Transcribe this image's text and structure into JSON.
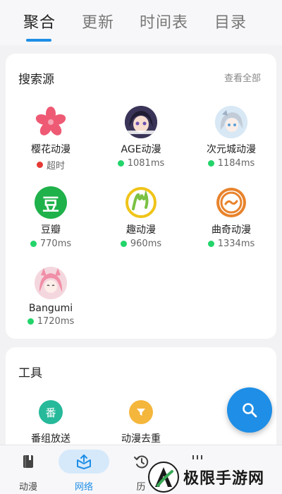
{
  "tabs": [
    {
      "label": "聚合",
      "active": true
    },
    {
      "label": "更新",
      "active": false
    },
    {
      "label": "时间表",
      "active": false
    },
    {
      "label": "目录",
      "active": false
    }
  ],
  "sources_card": {
    "title": "搜索源",
    "view_all": "查看全部",
    "items": [
      {
        "name": "樱花动漫",
        "status": "超时",
        "status_color": "#e53935",
        "icon": "sakura-flower-icon"
      },
      {
        "name": "AGE动漫",
        "status": "1081ms",
        "status_color": "#22d46a",
        "icon": "anime-girl-avatar"
      },
      {
        "name": "次元城动漫",
        "status": "1184ms",
        "status_color": "#22d46a",
        "icon": "anime-character-avatar"
      },
      {
        "name": "豆瓣",
        "status": "770ms",
        "status_color": "#22d46a",
        "icon": "douban-logo",
        "logo_text": "豆"
      },
      {
        "name": "趣动漫",
        "status": "960ms",
        "status_color": "#22d46a",
        "icon": "qudongman-logo"
      },
      {
        "name": "曲奇动漫",
        "status": "1334ms",
        "status_color": "#22d46a",
        "icon": "quqi-logo"
      },
      {
        "name": "Bangumi",
        "status": "1720ms",
        "status_color": "#22d46a",
        "icon": "bangumi-avatar"
      }
    ]
  },
  "tools_card": {
    "title": "工具",
    "items": [
      {
        "name": "番组放送",
        "icon": "broadcast-schedule-icon",
        "glyph": "番",
        "color": "#26b99a"
      },
      {
        "name": "动漫去重",
        "icon": "filter-icon",
        "color": "#f5b63c"
      }
    ]
  },
  "fab": {
    "icon": "search-icon",
    "color": "#1e8ee6"
  },
  "bottom_nav": [
    {
      "label": "动漫",
      "icon": "book-icon",
      "active": false
    },
    {
      "label": "网络",
      "icon": "network-box-icon",
      "active": true
    },
    {
      "label": "历",
      "icon": "history-icon",
      "active": false
    },
    {
      "label": "",
      "icon": "more-icon",
      "active": false
    }
  ],
  "watermark": {
    "text": "极限手游网"
  }
}
